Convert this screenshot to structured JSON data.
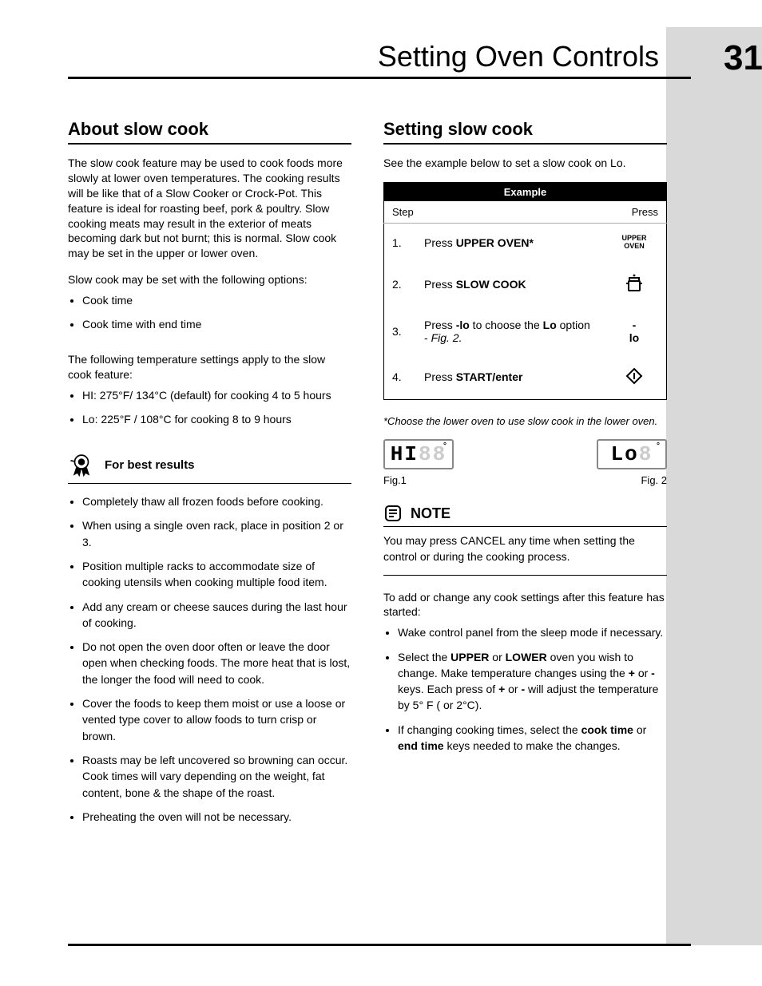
{
  "header": {
    "title": "Setting Oven Controls",
    "page_number": "31"
  },
  "left": {
    "heading": "About slow cook",
    "intro": "The slow cook feature may be used to cook foods more slowly at lower oven temperatures. The cooking results will be like that of a Slow Cooker or Crock-Pot. This feature is ideal for roasting beef, pork & poultry. Slow cooking meats may result in the exterior of meats becoming dark but not burnt; this is normal. Slow cook may be set in the upper or lower oven.",
    "options_intro": "Slow cook may be set with the following options:",
    "options": [
      "Cook time",
      "Cook time with end time"
    ],
    "temp_intro": "The following temperature settings apply to the slow cook feature:",
    "temps": [
      "HI: 275°F/ 134°C (default) for cooking 4 to 5 hours",
      "Lo: 225°F / 108°C for cooking 8 to 9 hours"
    ],
    "fbr_title": "For best results",
    "fbr_items": [
      "Completely thaw all frozen foods before cooking.",
      "When using a single oven rack, place in position 2 or 3.",
      "Position multiple racks to accommodate size of cooking utensils when cooking multiple food item.",
      "Add any cream or cheese sauces during the last hour of cooking.",
      "Do not open the oven door often or leave the door open when checking foods. The more heat that is lost, the longer the food will need to cook.",
      "Cover the foods to keep them moist or use a loose or vented type cover to allow foods to turn crisp or brown.",
      "Roasts may be left uncovered so browning can occur. Cook times will vary depending on the weight, fat content, bone & the shape of the roast.",
      "Preheating the oven will not be necessary."
    ]
  },
  "right": {
    "heading": "Setting slow cook",
    "intro": "See the example below to set a slow cook on Lo.",
    "example_label": "Example",
    "col_step": "Step",
    "col_press": "Press",
    "steps": [
      {
        "n": "1.",
        "pre": "Press ",
        "b": "UPPER OVEN*",
        "post": "",
        "press_type": "uo",
        "press_text": "UPPER\nOVEN"
      },
      {
        "n": "2.",
        "pre": "Press ",
        "b": "SLOW COOK",
        "post": "",
        "press_type": "pot"
      },
      {
        "n": "3.",
        "pre": "Press ",
        "b": "-lo",
        "mid": " to choose the ",
        "b2": "Lo",
        "post": " option - ",
        "i": "Fig. 2.",
        "press_type": "lo",
        "press_text": "-\nlo"
      },
      {
        "n": "4.",
        "pre": "Press ",
        "b": "START/enter",
        "post": "",
        "press_type": "start"
      }
    ],
    "footnote": "*Choose the lower oven to use slow cook in the lower oven.",
    "fig1_text": "HI",
    "fig2_text": "Lo",
    "fig1_cap": "Fig.1",
    "fig2_cap": "Fig. 2",
    "note_title": "NOTE",
    "note_body": "You may press CANCEL any time when setting the control or during the cooking process.",
    "after_intro": "To add or change any cook settings after this feature has started:",
    "after_items": [
      {
        "html": "Wake control panel from the sleep mode if necessary."
      },
      {
        "html": "Select the <b>UPPER</b> or <b>LOWER</b> oven you wish to change. Make temperature changes using the <b>+</b> or <b>-</b> keys. Each press of <b>+</b> or <b>-</b> will adjust the temperature by 5° F ( or 2°C)."
      },
      {
        "html": "If changing cooking times, select the <b>cook time</b> or <b>end time</b> keys needed to make the changes."
      }
    ]
  }
}
